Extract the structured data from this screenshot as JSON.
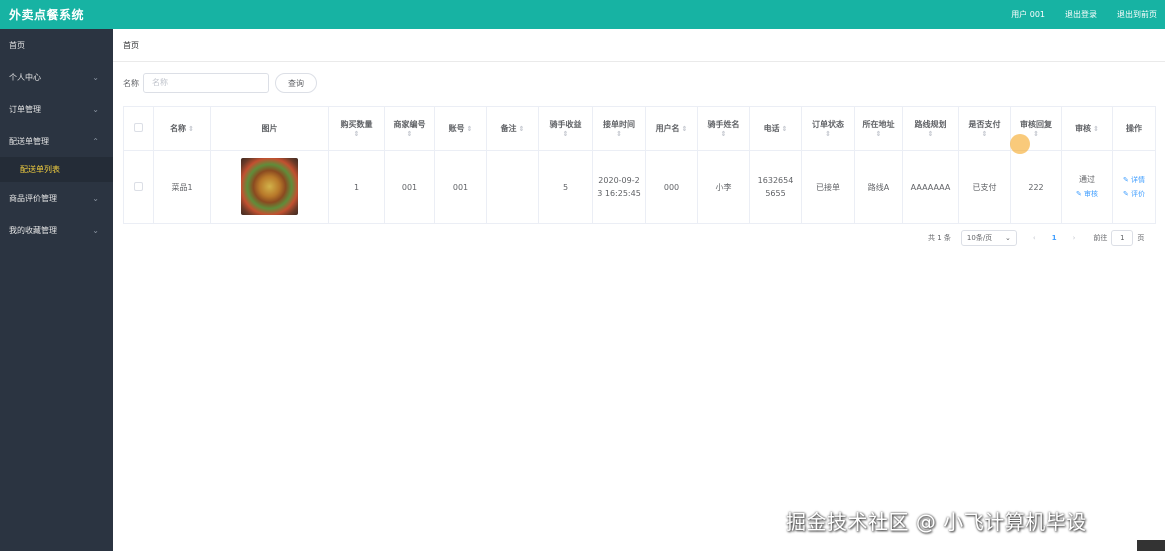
{
  "header": {
    "title": "外卖点餐系统",
    "user": "用户 001",
    "logout": "退出登录",
    "exit_home": "退出到前页"
  },
  "sidebar": {
    "items": [
      {
        "label": "首页"
      },
      {
        "label": "个人中心"
      },
      {
        "label": "订单管理"
      },
      {
        "label": "配送单管理"
      },
      {
        "label": "商品评价管理"
      },
      {
        "label": "我的收藏管理"
      }
    ],
    "submenu_active": "配送单列表"
  },
  "breadcrumb": "首页",
  "search": {
    "label": "名称",
    "placeholder": "名称",
    "button": "查询"
  },
  "table": {
    "headers": [
      "名称",
      "图片",
      "购买数量",
      "商家编号",
      "账号",
      "备注",
      "骑手收益",
      "接单时间",
      "用户名",
      "骑手姓名",
      "电话",
      "订单状态",
      "所在地址",
      "路线规划",
      "是否支付",
      "审核回复",
      "审核",
      "操作"
    ],
    "row": {
      "name": "菜品1",
      "quantity": "1",
      "merchant_no": "001",
      "account": "001",
      "remark": "",
      "income": "5",
      "time": "2020-09-23 16:25:45",
      "username": "000",
      "rider": "小李",
      "phone": "16326545655",
      "status": "已接单",
      "address": "路线A",
      "route": "AAAAAAA",
      "paid": "已支付",
      "reply": "222",
      "audit": "通过",
      "audit_link": "审核",
      "detail_link": "详情",
      "review_link": "评价"
    }
  },
  "pagination": {
    "total": "共 1 条",
    "page_size": "10条/页",
    "current": "1",
    "goto_prefix": "前往",
    "goto_value": "1",
    "goto_suffix": "页"
  },
  "watermark": "掘金技术社区 @ 小飞计算机毕设"
}
